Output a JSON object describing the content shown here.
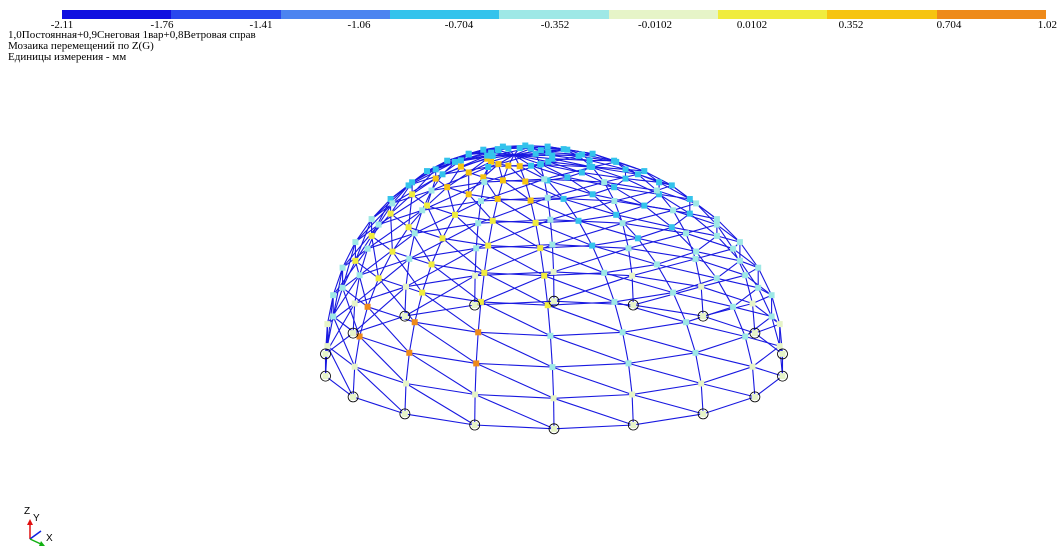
{
  "legend": {
    "colors": [
      "#1010e0",
      "#2848ee",
      "#4c84f0",
      "#34c3ec",
      "#9ee8e6",
      "#e6f4c8",
      "#f0ec3e",
      "#f6c410",
      "#ee8a1a"
    ],
    "ticks": [
      "-2.11",
      "-1.76",
      "-1.41",
      "-1.06",
      "-0.704",
      "-0.352",
      "-0.0102",
      "0.0102",
      "0.352",
      "0.704",
      "1.02"
    ]
  },
  "info": {
    "load_case": "1,0Постоянная+0,9Снеговая 1вар+0,8Ветровая справ",
    "mosaic_title": "Мозаика перемещений по Z(G)",
    "units": "Единицы измерения - мм"
  },
  "axes": {
    "z": "Z",
    "y": "Y",
    "x": "X"
  },
  "model": {
    "line_color": "#1818e0",
    "support_color": "#000000"
  }
}
